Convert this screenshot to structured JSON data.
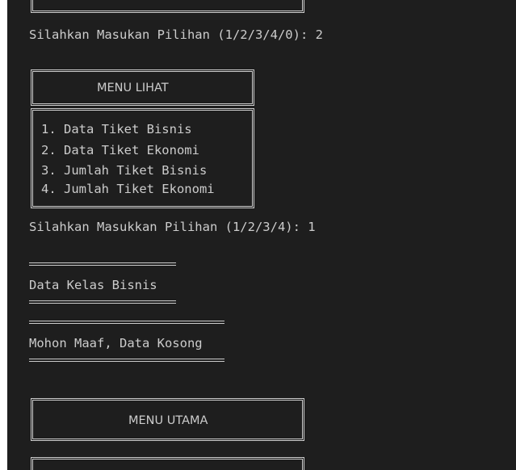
{
  "terminal": {
    "prompt_main": "Silahkan Masukan Pilihan (1/2/3/4/0): 2",
    "menu_lihat": {
      "title": "MENU LIHAT",
      "items": [
        "1. Data Tiket Bisnis",
        "2. Data Tiket Ekonomi",
        "3. Jumlah Tiket Bisnis",
        "4. Jumlah Tiket Ekonomi"
      ]
    },
    "prompt_lihat": "Silahkan Masukkan Pilihan (1/2/3/4): 1",
    "section_title": "Data Kelas Bisnis",
    "message": "Mohon Maaf, Data Kosong",
    "menu_utama": {
      "title": "MENU UTAMA"
    }
  },
  "colors": {
    "background": "#1e1e1e",
    "text": "#cccccc"
  }
}
